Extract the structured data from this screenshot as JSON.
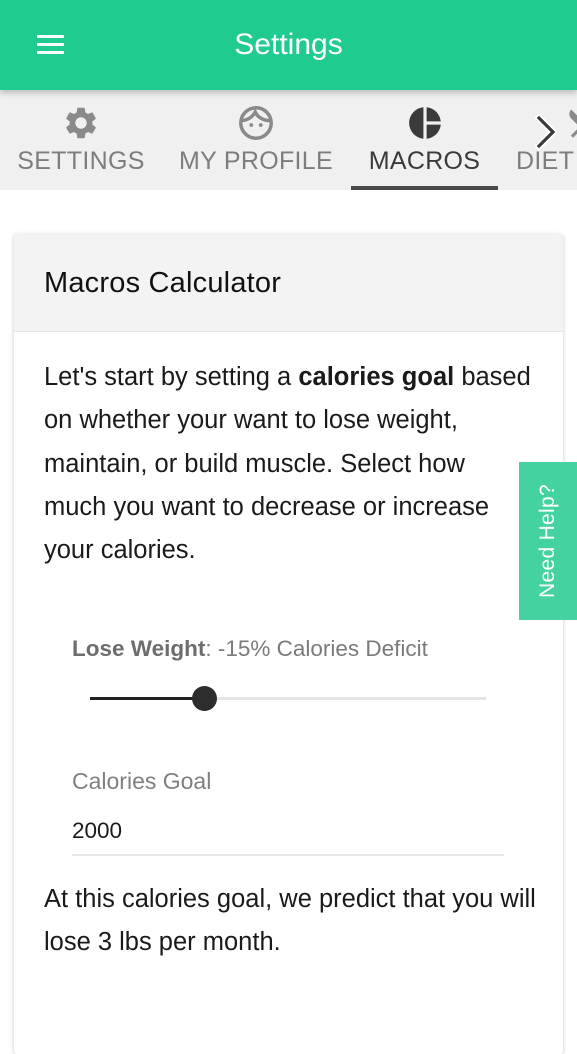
{
  "app_bar": {
    "title": "Settings",
    "menu_icon": "hamburger-menu-icon"
  },
  "tabs": [
    {
      "label": "SETTINGS",
      "icon": "gear-icon",
      "active": false
    },
    {
      "label": "MY PROFILE",
      "icon": "face-icon",
      "active": false
    },
    {
      "label": "MACROS",
      "icon": "pie-chart-icon",
      "active": true
    },
    {
      "label": "DIET",
      "icon": "fork-knife-icon",
      "active": false
    }
  ],
  "tab_scroll_icon": "chevron-right-icon",
  "card": {
    "title": "Macros Calculator",
    "intro_before": "Let's start by setting a ",
    "intro_bold": "calories goal",
    "intro_after": " based on whether your want to lose weight, maintain, or build muscle. Select how much you want to decrease or increase your calories.",
    "slider": {
      "label_bold": "Lose Weight",
      "label_rest": ": -15% Calories Deficit",
      "value_fraction": 0.29
    },
    "calories_goal": {
      "label": "Calories Goal",
      "value": "2000"
    },
    "prediction": "At this calories goal, we predict that you will lose 3 lbs per month."
  },
  "need_help": {
    "label": "Need Help?"
  },
  "colors": {
    "primary": "#1fcb8f",
    "help_tab": "#44d3a0",
    "tab_bar_bg": "#f0f0f0",
    "active_tab": "#3a3a3a"
  }
}
